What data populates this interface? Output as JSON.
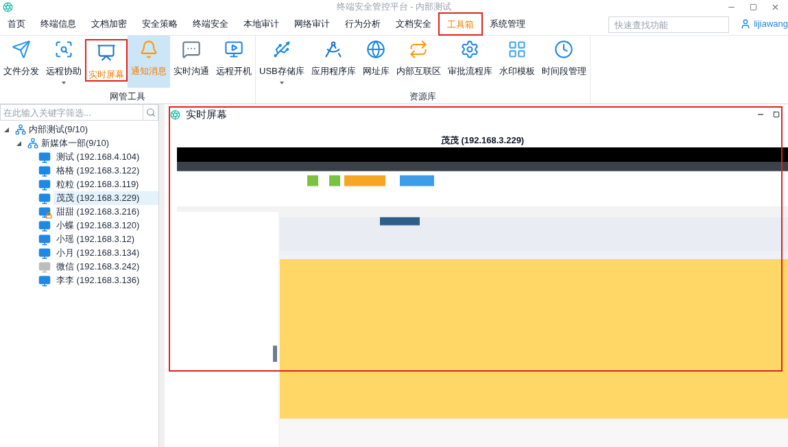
{
  "window": {
    "title": "终端安全管控平台 - 内部测试"
  },
  "menu_tabs": [
    {
      "label": "首页",
      "selected": false,
      "outlined": false
    },
    {
      "label": "终端信息",
      "selected": false,
      "outlined": false
    },
    {
      "label": "文档加密",
      "selected": false,
      "outlined": false
    },
    {
      "label": "安全策略",
      "selected": false,
      "outlined": false
    },
    {
      "label": "终端安全",
      "selected": false,
      "outlined": false
    },
    {
      "label": "本地审计",
      "selected": false,
      "outlined": false
    },
    {
      "label": "网络审计",
      "selected": false,
      "outlined": false
    },
    {
      "label": "行为分析",
      "selected": false,
      "outlined": false
    },
    {
      "label": "文档安全",
      "selected": false,
      "outlined": false
    },
    {
      "label": "工具箱",
      "selected": true,
      "outlined": true
    },
    {
      "label": "系统管理",
      "selected": false,
      "outlined": false
    }
  ],
  "search": {
    "placeholder": "快速查找功能"
  },
  "user": {
    "name": "lijiawang"
  },
  "ribbon_groups": [
    {
      "title": "网管工具",
      "items": [
        {
          "label": "文件分发",
          "selected": false,
          "hovered": false,
          "dropdown": false
        },
        {
          "label": "远程协助",
          "selected": false,
          "hovered": false,
          "dropdown": true
        },
        {
          "label": "实时屏幕",
          "selected": true,
          "hovered": false,
          "dropdown": false
        },
        {
          "label": "通知消息",
          "selected": false,
          "hovered": true,
          "dropdown": false
        },
        {
          "label": "实时沟通",
          "selected": false,
          "hovered": false,
          "dropdown": false
        },
        {
          "label": "远程开机",
          "selected": false,
          "hovered": false,
          "dropdown": false
        }
      ]
    },
    {
      "title": "资源库",
      "items": [
        {
          "label": "USB存储库",
          "selected": false,
          "hovered": false,
          "dropdown": true
        },
        {
          "label": "应用程序库",
          "selected": false,
          "hovered": false,
          "dropdown": false
        },
        {
          "label": "网址库",
          "selected": false,
          "hovered": false,
          "dropdown": false
        },
        {
          "label": "内部互联区",
          "selected": false,
          "hovered": false,
          "dropdown": false
        },
        {
          "label": "审批流程库",
          "selected": false,
          "hovered": false,
          "dropdown": false
        },
        {
          "label": "水印模板",
          "selected": false,
          "hovered": false,
          "dropdown": false
        },
        {
          "label": "时间段管理",
          "selected": false,
          "hovered": false,
          "dropdown": false
        }
      ]
    }
  ],
  "filter": {
    "placeholder": "在此输入关键字筛选..."
  },
  "tree": [
    {
      "label": "内部测试(9/10)",
      "kind": "group",
      "expanded": true,
      "children": [
        {
          "label": "新媒体一部(9/10)",
          "kind": "group",
          "expanded": true,
          "children": [
            {
              "label": "测试 (192.168.4.104)",
              "kind": "computer",
              "locked": false,
              "offline": false,
              "selected": false
            },
            {
              "label": "格格 (192.168.3.122)",
              "kind": "computer",
              "locked": false,
              "offline": false,
              "selected": false
            },
            {
              "label": "粒粒 (192.168.3.119)",
              "kind": "computer",
              "locked": false,
              "offline": false,
              "selected": false
            },
            {
              "label": "茂茂 (192.168.3.229)",
              "kind": "computer",
              "locked": false,
              "offline": false,
              "selected": true
            },
            {
              "label": "甜甜 (192.168.3.216)",
              "kind": "computer",
              "locked": true,
              "offline": false,
              "selected": false
            },
            {
              "label": "小蝶 (192.168.3.120)",
              "kind": "computer",
              "locked": false,
              "offline": false,
              "selected": false
            },
            {
              "label": "小瑶 (192.168.3.12)",
              "kind": "computer",
              "locked": false,
              "offline": false,
              "selected": false
            },
            {
              "label": "小月 (192.168.3.134)",
              "kind": "computer",
              "locked": false,
              "offline": false,
              "selected": false
            },
            {
              "label": "微信 (192.168.3.242)",
              "kind": "computer",
              "locked": false,
              "offline": true,
              "selected": false
            },
            {
              "label": "李李 (192.168.3.136)",
              "kind": "computer",
              "locked": false,
              "offline": false,
              "selected": false
            }
          ]
        }
      ]
    }
  ],
  "panel": {
    "title": "实时屏幕",
    "outlined": true,
    "screen_caption": "茂茂 (192.168.3.229)"
  }
}
